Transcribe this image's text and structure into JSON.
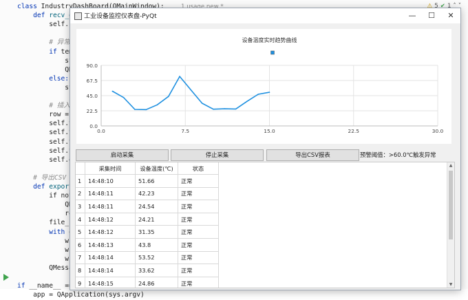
{
  "ide": {
    "code_lines": [
      {
        "segments": [
          {
            "t": "class ",
            "c": "kw"
          },
          {
            "t": "IndustryDashBoard(QMainWindow):",
            "c": ""
          }
        ]
      },
      {
        "segments": [
          {
            "t": "    def ",
            "c": "kw"
          },
          {
            "t": "recv_data",
            "c": "fn"
          }
        ]
      },
      {
        "segments": [
          {
            "t": "        self.",
            "c": ""
          }
        ]
      },
      {
        "segments": [
          {
            "t": "",
            "c": ""
          }
        ]
      },
      {
        "segments": [
          {
            "t": "        # 异常预警",
            "c": "cm"
          }
        ]
      },
      {
        "segments": [
          {
            "t": "        if ",
            "c": "kw"
          },
          {
            "t": "temp >",
            "c": ""
          }
        ]
      },
      {
        "segments": [
          {
            "t": "            statu",
            "c": ""
          }
        ]
      },
      {
        "segments": [
          {
            "t": "            QMess",
            "c": ""
          }
        ]
      },
      {
        "segments": [
          {
            "t": "        else:",
            "c": "kw"
          }
        ]
      },
      {
        "segments": [
          {
            "t": "            statu",
            "c": ""
          }
        ]
      },
      {
        "segments": [
          {
            "t": "",
            "c": ""
          }
        ]
      },
      {
        "segments": [
          {
            "t": "        # 插入表格",
            "c": "cm"
          }
        ]
      },
      {
        "segments": [
          {
            "t": "        row = sel",
            "c": ""
          }
        ]
      },
      {
        "segments": [
          {
            "t": "        self.tabl",
            "c": ""
          }
        ]
      },
      {
        "segments": [
          {
            "t": "        self.tabl",
            "c": ""
          }
        ]
      },
      {
        "segments": [
          {
            "t": "        self.tabl",
            "c": ""
          }
        ]
      },
      {
        "segments": [
          {
            "t": "        self.tabl",
            "c": ""
          }
        ]
      },
      {
        "segments": [
          {
            "t": "        self.data",
            "c": ""
          }
        ]
      },
      {
        "segments": [
          {
            "t": "",
            "c": ""
          }
        ]
      },
      {
        "segments": [
          {
            "t": "    # 导出CSV",
            "c": "cm"
          }
        ]
      },
      {
        "segments": [
          {
            "t": "    def ",
            "c": "kw"
          },
          {
            "t": "export_cs",
            "c": "fn"
          }
        ]
      },
      {
        "segments": [
          {
            "t": "        if not se",
            "c": ""
          }
        ]
      },
      {
        "segments": [
          {
            "t": "            QMess",
            "c": ""
          }
        ]
      },
      {
        "segments": [
          {
            "t": "            retur",
            "c": ""
          }
        ]
      },
      {
        "segments": [
          {
            "t": "        file_name",
            "c": ""
          }
        ]
      },
      {
        "segments": [
          {
            "t": "        with ",
            "c": "kw"
          },
          {
            "t": "open",
            "c": ""
          }
        ]
      },
      {
        "segments": [
          {
            "t": "            write",
            "c": ""
          }
        ]
      },
      {
        "segments": [
          {
            "t": "            write",
            "c": ""
          }
        ]
      },
      {
        "segments": [
          {
            "t": "            write",
            "c": ""
          }
        ]
      },
      {
        "segments": [
          {
            "t": "        QMessageB",
            "c": ""
          }
        ]
      },
      {
        "segments": [
          {
            "t": "",
            "c": ""
          }
        ]
      },
      {
        "segments": [
          {
            "t": "if ",
            "c": "kw"
          },
          {
            "t": "__name__ == \"",
            "c": ""
          }
        ]
      },
      {
        "segments": [
          {
            "t": "    app = QApplication(sys.argv)",
            "c": ""
          }
        ]
      }
    ],
    "usage_hint": "1 usage   new *",
    "status": {
      "warnings": "5",
      "checks": "1"
    }
  },
  "window": {
    "title": "工业设备监控仪表盘-PyQt",
    "minimize": "—",
    "maximize": "☐",
    "close": "✕"
  },
  "chart_data": {
    "type": "line",
    "title": "设备温度实时趋势曲线",
    "xlim": [
      0,
      30
    ],
    "ylim": [
      0,
      90
    ],
    "xticks": [
      "0.0",
      "7.5",
      "15.0",
      "22.5",
      "30.0"
    ],
    "yticks": [
      "0.0",
      "22.5",
      "45.0",
      "67.5",
      "90.0"
    ],
    "grid": true,
    "legend": "top-center",
    "line_color": "#1e90e0",
    "x": [
      1,
      2,
      3,
      4,
      5,
      6,
      7,
      8,
      9,
      10,
      11,
      12,
      13,
      14,
      15
    ],
    "y": [
      51.66,
      42.23,
      24.54,
      24.21,
      31.35,
      43.8,
      73.5,
      53.52,
      33.62,
      24.86,
      25.5,
      25.2,
      36.5,
      47.0,
      50.0
    ]
  },
  "buttons": {
    "start": "启动采集",
    "stop": "停止采集",
    "export": "导出CSV报表"
  },
  "alarm_label": "预警阈值：>60.0℃触发异常",
  "table": {
    "headers": [
      "采集时间",
      "设备温度(℃)",
      "状态"
    ],
    "rows": [
      [
        "1",
        "14:48:10",
        "51.66",
        "正常"
      ],
      [
        "2",
        "14:48:11",
        "42.23",
        "正常"
      ],
      [
        "3",
        "14:48:11",
        "24.54",
        "正常"
      ],
      [
        "4",
        "14:48:12",
        "24.21",
        "正常"
      ],
      [
        "5",
        "14:48:12",
        "31.35",
        "正常"
      ],
      [
        "6",
        "14:48:13",
        "43.8",
        "正常"
      ],
      [
        "7",
        "14:48:14",
        "53.52",
        "正常"
      ],
      [
        "8",
        "14:48:14",
        "33.62",
        "正常"
      ],
      [
        "9",
        "14:48:15",
        "24.86",
        "正常"
      ]
    ]
  }
}
